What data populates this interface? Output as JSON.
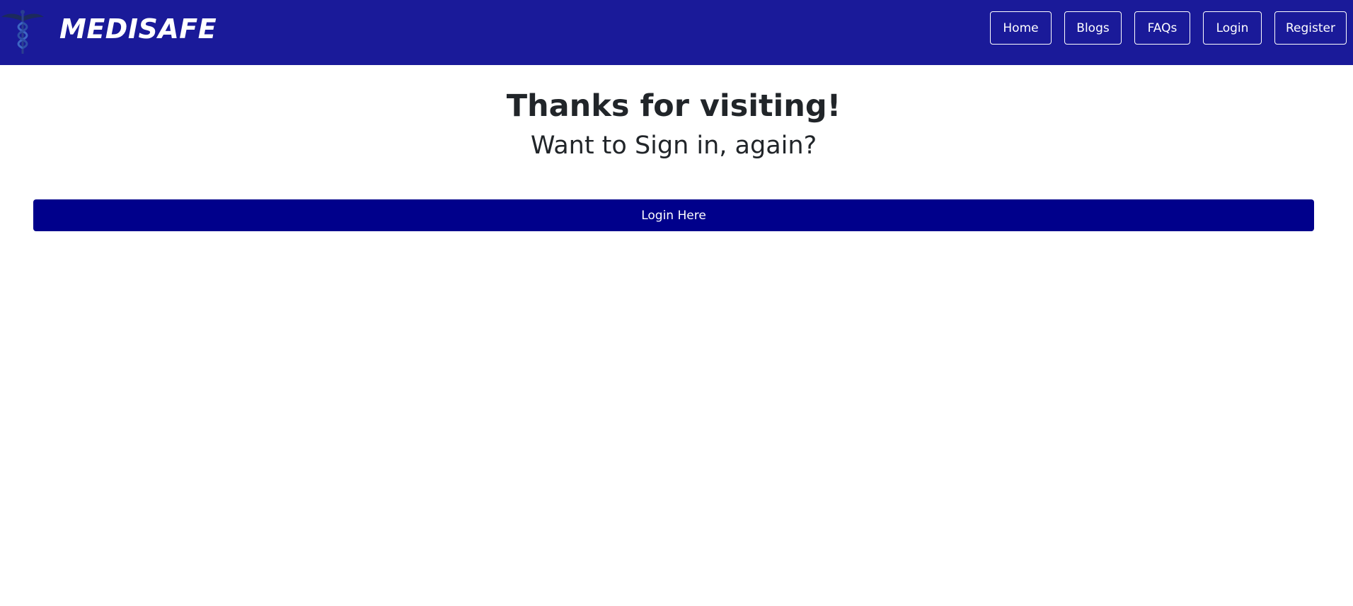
{
  "colors": {
    "navbar_bg": "#1a1a99",
    "primary_button": "#00008b",
    "heading_text": "#212529"
  },
  "navbar": {
    "brand": "MEDISAFE",
    "logo_icon": "caduceus-icon",
    "links": {
      "home": "Home",
      "blogs": "Blogs",
      "faqs": "FAQs",
      "login": "Login",
      "register": "Register"
    }
  },
  "main": {
    "title": "Thanks for visiting!",
    "subtitle": "Want to Sign in, again?",
    "login_button": "Login Here"
  }
}
